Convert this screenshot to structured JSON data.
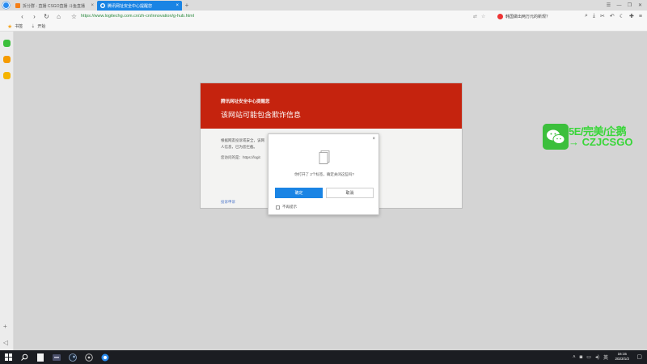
{
  "tabs": [
    {
      "label": "拆分群 - 直播 CSGO直播 斗鱼直播",
      "active": false
    },
    {
      "label": "腾讯网址安全中心提醒您",
      "active": true
    }
  ],
  "address": {
    "url": "https://www.logitechg.com.cn/zh-cn/innovation/g-hub.html"
  },
  "search_widget": {
    "text": "韩国做出两万元的新规？"
  },
  "bookmarks": [
    {
      "label": "书签",
      "icon": "star-icon"
    },
    {
      "label": "开始",
      "icon": "folder-icon"
    }
  ],
  "warning": {
    "brand": "腾讯网址安全中心提醒您",
    "title": "该网站可能包含欺诈信息",
    "body_line1": "根据网友投诉或安全，该网",
    "body_line2": "人信息，已为您拦截。",
    "body_line3": "您访问的是：https://logit",
    "right_fragment_1": "",
    "right_fragment_2": "",
    "link": "投诉申诉"
  },
  "dialog": {
    "message": "你打开了 2个标签，确定关闭这些吗?",
    "ok_label": "确定",
    "cancel_label": "取消",
    "checkbox_label": "不再提示"
  },
  "watermark": {
    "line1": "5E/完美/企鹅",
    "line2": "→ CZJCSGO"
  },
  "taskbar": {
    "time": "16:15",
    "date": "2023/1/2"
  },
  "colors": {
    "warning_red": "#c5230e",
    "browser_blue": "#1a84e4",
    "watermark_green": "#39d639"
  }
}
